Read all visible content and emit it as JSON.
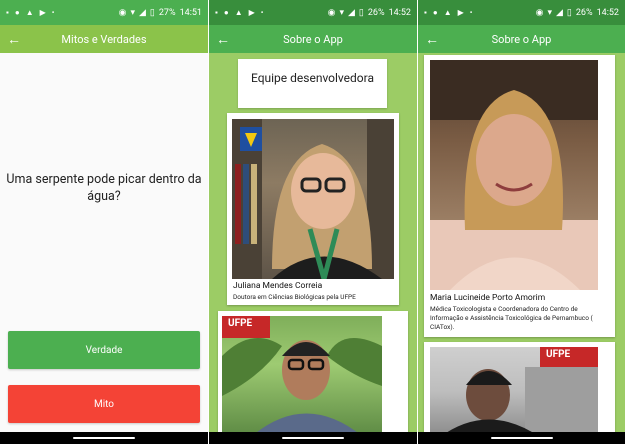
{
  "statusbar_left": {
    "p1": {
      "battery": "27%",
      "time": "14:51"
    },
    "p2": {
      "battery": "26%",
      "time": "14:52"
    },
    "p3": {
      "battery": "26%",
      "time": "14:52"
    }
  },
  "screen1": {
    "title": "Mitos e Verdades",
    "question": "Uma serpente pode picar dentro da água?",
    "true_label": "Verdade",
    "myth_label": "Mito"
  },
  "screen2": {
    "title": "Sobre o App",
    "team_heading": "Equipe desenvolvedora",
    "person1": {
      "name": "Juliana Mendes Correia",
      "role": "Doutora em Ciências Biológicas pela UFPE"
    },
    "logo_text": "UFPE"
  },
  "screen3": {
    "title": "Sobre o App",
    "person1": {
      "name": "Maria Lucineide Porto Amorim",
      "role": "Médica Toxicologista e Coordenadora do Centro de Informação e Assistência Toxicológica de Pernambuco ( CIATox)."
    },
    "logo_text": "UFPE"
  },
  "colors": {
    "status_light": "#4caf50",
    "status_dark": "#388e3c",
    "appbar_light": "#8bc34a",
    "appbar": "#4caf50",
    "background_green": "#9ccc65",
    "true_button": "#4caf50",
    "myth_button": "#f44336"
  },
  "icons": [
    "back-arrow-icon",
    "wifi-icon",
    "signal-icon",
    "battery-icon",
    "eye-icon",
    "alarm-icon"
  ]
}
